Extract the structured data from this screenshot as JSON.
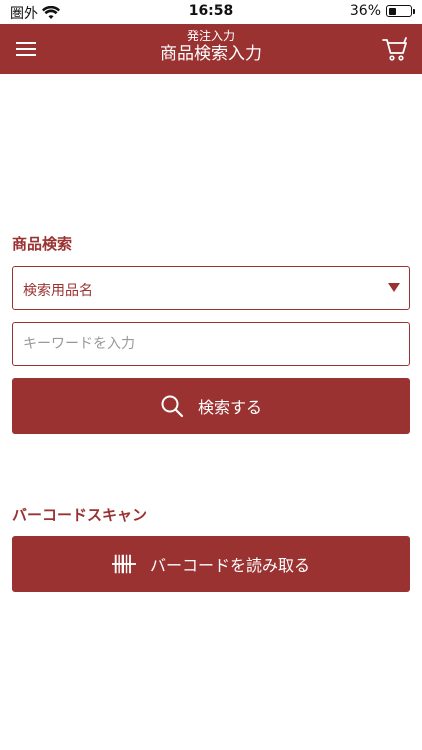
{
  "status_bar": {
    "carrier": "圏外",
    "time": "16:58",
    "battery": "36%",
    "battery_level": 0.36
  },
  "header": {
    "subtitle": "発注入力",
    "title": "商品検索入力",
    "menu_icon": "hamburger-menu-icon",
    "cart_icon": "cart-icon"
  },
  "product_search": {
    "section_title": "商品検索",
    "category_select_value": "検索用品名",
    "keyword_placeholder": "キーワードを入力",
    "keyword_value": "",
    "search_button_label": "検索する",
    "search_icon": "search-icon"
  },
  "barcode": {
    "section_title": "バーコードスキャン",
    "button_label": "バーコードを読み取る",
    "barcode_icon": "barcode-icon"
  },
  "colors": {
    "accent": "#9b3232",
    "white": "#ffffff",
    "placeholder": "#999999"
  }
}
